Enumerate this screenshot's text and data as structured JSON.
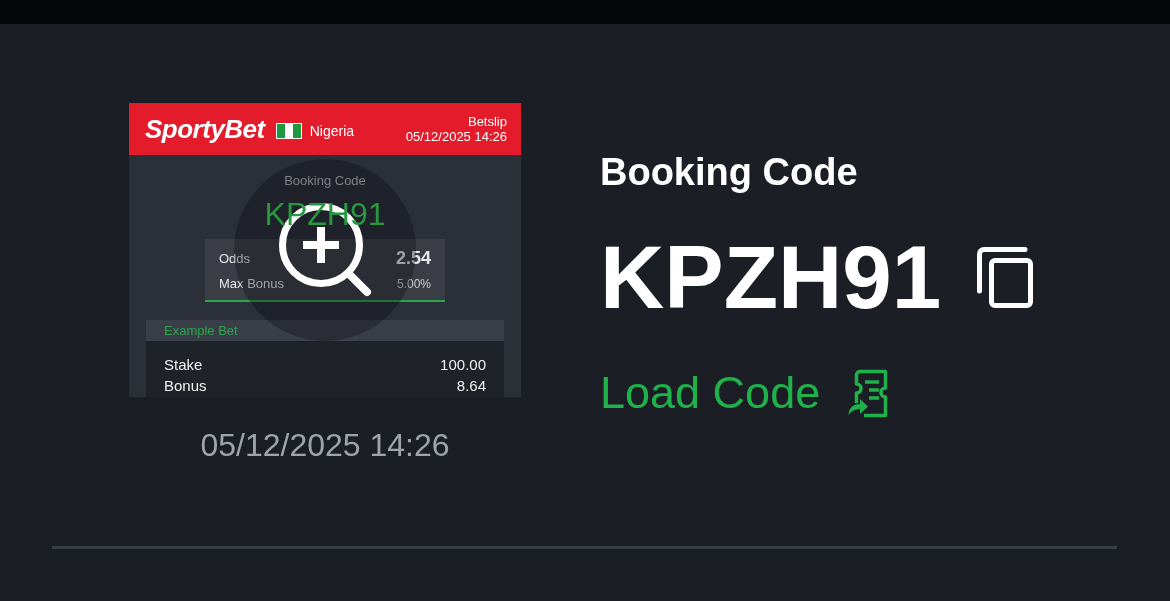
{
  "betslip_preview": {
    "header": {
      "logo": "SportyBet",
      "country": "Nigeria",
      "title": "Betslip",
      "datetime": "05/12/2025 14:26"
    },
    "booking_code_label": "Booking Code",
    "booking_code": "KPZH91",
    "summary": [
      {
        "kind": "main",
        "label": "Odds",
        "value": "2.54"
      },
      {
        "kind": "minor",
        "label": "Max Bonus",
        "value": "5.00%"
      }
    ],
    "example_bet": {
      "title": "Example Bet",
      "rows": [
        {
          "label": "Stake",
          "value": "100.00"
        },
        {
          "label": "Bonus",
          "value": "8.64"
        }
      ]
    }
  },
  "preview_timestamp": "05/12/2025 14:26",
  "booking_code": {
    "label": "Booking Code",
    "code": "KPZH91"
  },
  "load_code": "Load Code"
}
